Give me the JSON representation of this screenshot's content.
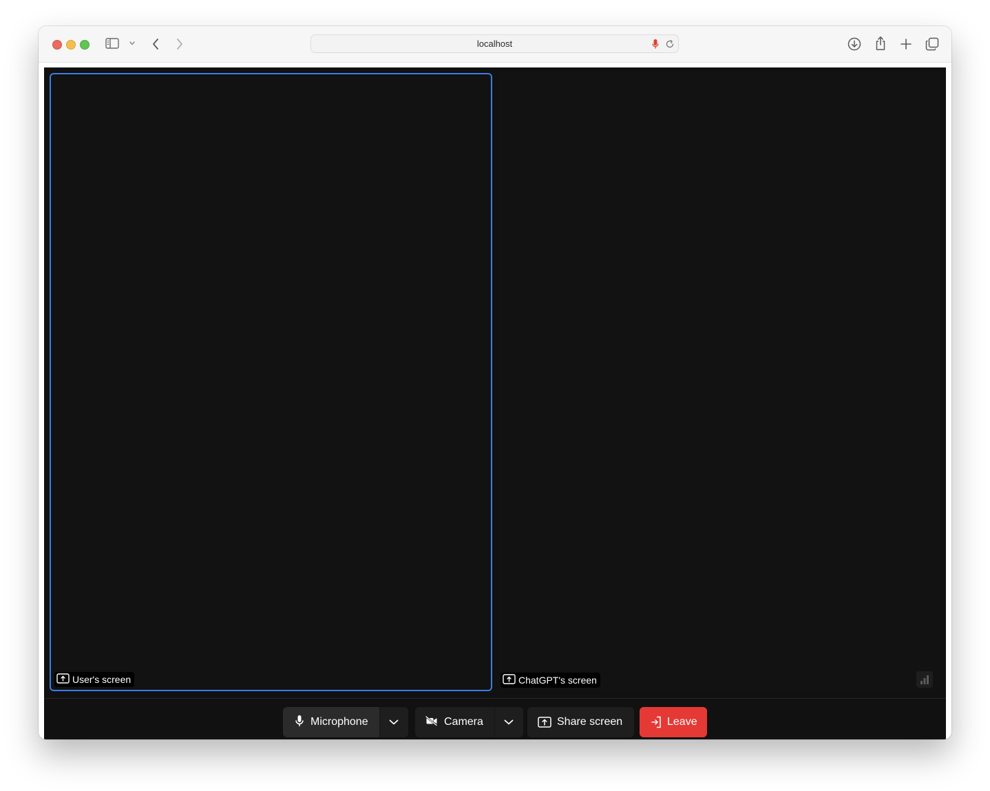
{
  "browser": {
    "url": "localhost",
    "icons": [
      "sidebar-icon",
      "chevron-down-icon",
      "back-arrow-icon",
      "forward-arrow-icon",
      "microphone-active-icon",
      "reload-icon",
      "download-icon",
      "share-icon",
      "new-tab-icon",
      "tab-overview-icon"
    ]
  },
  "tiles": {
    "user": {
      "label": "User's screen",
      "icon": "screen-share-icon",
      "highlight_color": "#3b7de6"
    },
    "gpt": {
      "label": "ChatGPT's screen",
      "icon": "screen-share-icon",
      "status_icon": "connection-quality-icon"
    }
  },
  "controls": {
    "microphone": {
      "label": "Microphone",
      "icon": "microphone-icon",
      "menu_icon": "chevron-down-icon"
    },
    "camera": {
      "label": "Camera",
      "icon": "camera-off-icon",
      "menu_icon": "chevron-down-icon"
    },
    "share": {
      "label": "Share screen",
      "icon": "screen-share-icon"
    },
    "leave": {
      "label": "Leave",
      "icon": "leave-icon",
      "color": "#e53935"
    }
  }
}
